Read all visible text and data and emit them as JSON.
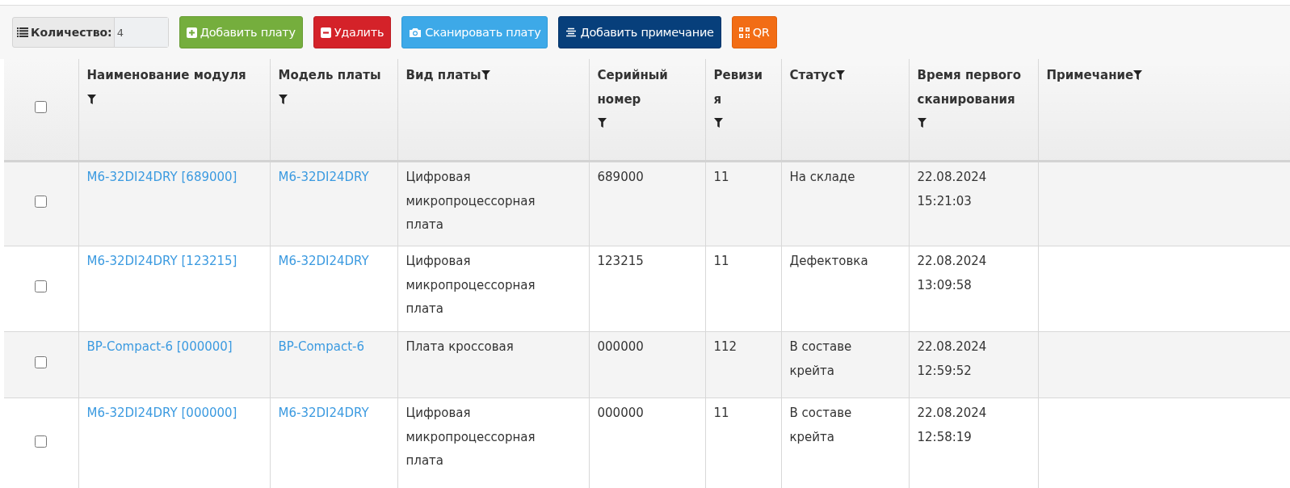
{
  "toolbar": {
    "count": {
      "label": "Количество:",
      "value": "4"
    },
    "buttons": [
      {
        "kind": "add",
        "label": "Добавить плату"
      },
      {
        "kind": "delete",
        "label": "Удалить"
      },
      {
        "kind": "scan",
        "label": "Сканировать плату"
      },
      {
        "kind": "note",
        "label": "Добавить примечание"
      },
      {
        "kind": "qr",
        "label": "QR"
      }
    ]
  },
  "table": {
    "select_all": {
      "checked": false
    },
    "columns": [
      {
        "label": "Наименование модуля"
      },
      {
        "label": "Модель платы"
      },
      {
        "label": "Вид платы"
      },
      {
        "label": "Серийный номер"
      },
      {
        "label": "Ревизия"
      },
      {
        "label": "Статус"
      },
      {
        "label": "Время первого сканирования"
      },
      {
        "label": "Примечание"
      }
    ],
    "rows": [
      {
        "checked": false,
        "cells": [
          "M6-32DI24DRY [689000]",
          "M6-32DI24DRY",
          "Цифровая микропроцессорная плата",
          "689000",
          "11",
          "На складе",
          "22.08.2024 15:21:03",
          ""
        ]
      },
      {
        "checked": false,
        "cells": [
          "M6-32DI24DRY [123215]",
          "M6-32DI24DRY",
          "Цифровая микропроцессорная плата",
          "123215",
          "11",
          "Дефектовка",
          "22.08.2024 13:09:58",
          ""
        ]
      },
      {
        "checked": false,
        "cells": [
          "BP-Compact-6 [000000]",
          "BP-Compact-6",
          "Плата кроссовая",
          "000000",
          "112",
          "В составе крейта",
          "22.08.2024 12:59:52",
          ""
        ]
      },
      {
        "checked": false,
        "cells": [
          "M6-32DI24DRY [000000]",
          "M6-32DI24DRY",
          "Цифровая микропроцессорная плата",
          "000000",
          "11",
          "В составе крейта",
          "22.08.2024 12:58:19",
          ""
        ]
      }
    ]
  }
}
